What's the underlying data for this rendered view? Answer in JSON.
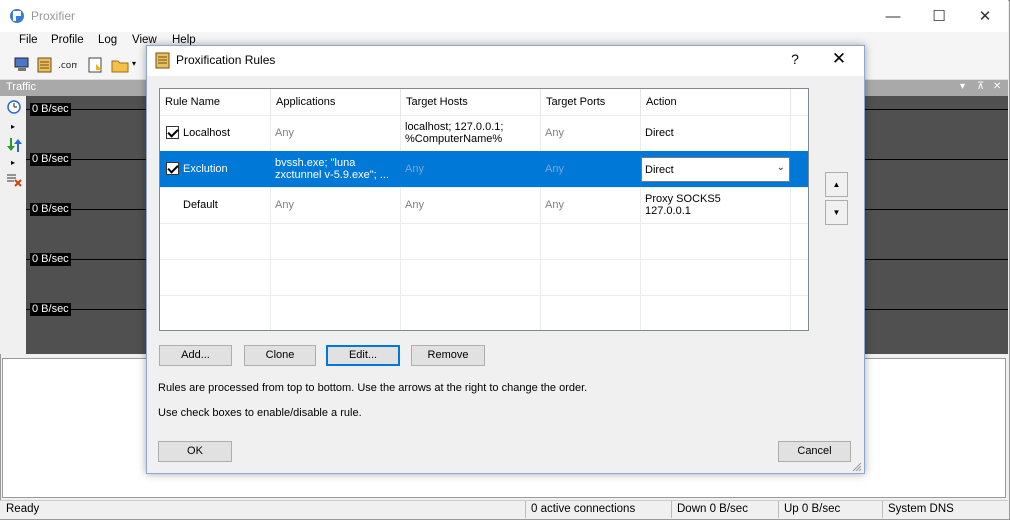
{
  "app": {
    "title": "Proxifier"
  },
  "window_controls": {
    "minimize": "—",
    "maximize": "☐",
    "close": "✕"
  },
  "menu": [
    "File",
    "Profile",
    "Log",
    "View",
    "Help"
  ],
  "traffic": {
    "title": "Traffic",
    "labels": [
      "0 B/sec",
      "0 B/sec",
      "0 B/sec",
      "0 B/sec",
      "0 B/sec"
    ],
    "header_controls": [
      "▾",
      "⊼",
      "✕"
    ]
  },
  "status": {
    "ready": "Ready",
    "connections": "0 active connections",
    "down": "Down 0 B/sec",
    "up": "Up 0 B/sec",
    "dns": "System DNS"
  },
  "dialog": {
    "title": "Proxification Rules",
    "help": "?",
    "close": "✕",
    "columns": [
      "Rule Name",
      "Applications",
      "Target Hosts",
      "Target Ports",
      "Action"
    ],
    "rules": [
      {
        "checked": true,
        "name": "Localhost",
        "applications": "Any",
        "hosts_line1": "localhost; 127.0.0.1;",
        "hosts_line2": "%ComputerName%",
        "ports": "Any",
        "action_line1": "Direct",
        "action_line2": ""
      },
      {
        "checked": true,
        "name": "Exclution",
        "applications_line1": "bvssh.exe; \"luna",
        "applications_line2": "zxctunnel v-5.9.exe\"; ...",
        "hosts": "Any",
        "ports": "Any",
        "action": "Direct",
        "selected": true
      },
      {
        "checked": false,
        "name": "Default",
        "applications": "Any",
        "hosts": "Any",
        "ports": "Any",
        "action_line1": "Proxy SOCKS5",
        "action_line2": "127.0.0.1"
      }
    ],
    "buttons": {
      "add": "Add...",
      "clone": "Clone",
      "edit": "Edit...",
      "remove": "Remove",
      "ok": "OK",
      "cancel": "Cancel"
    },
    "move_up_icon": "up-arrow-icon",
    "move_down_icon": "down-arrow-icon",
    "info_order": "Rules are processed from top to bottom. Use the arrows at the right to change the order.",
    "info_checkbox": "Use check boxes to enable/disable a rule."
  },
  "colors": {
    "selection": "#0078d7",
    "graph_bg": "#505050"
  }
}
